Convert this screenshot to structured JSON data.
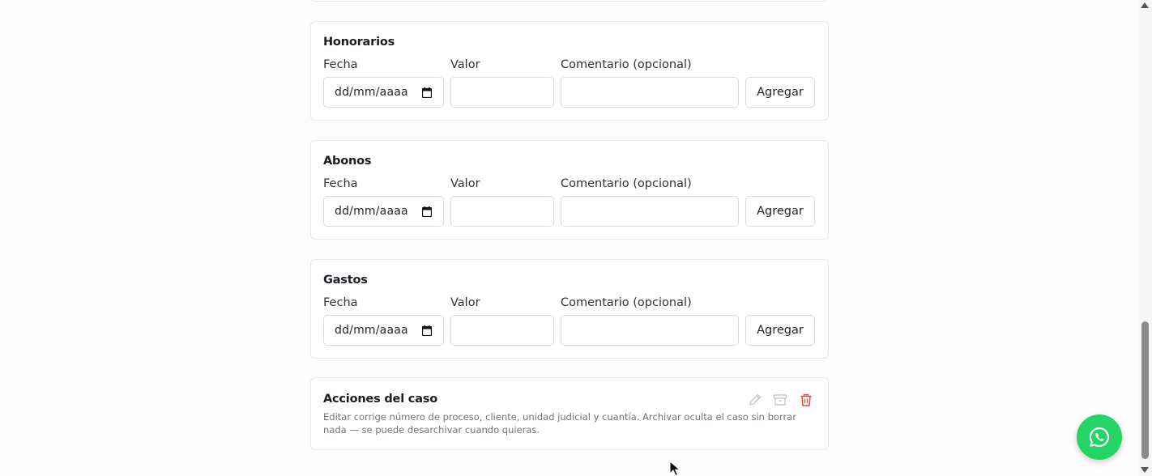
{
  "sections": [
    {
      "title": "Honorarios",
      "fecha_label": "Fecha",
      "valor_label": "Valor",
      "comentario_label": "Comentario (opcional)",
      "date_placeholder": "dd/mm/aaaa",
      "button_label": "Agregar"
    },
    {
      "title": "Abonos",
      "fecha_label": "Fecha",
      "valor_label": "Valor",
      "comentario_label": "Comentario (opcional)",
      "date_placeholder": "dd/mm/aaaa",
      "button_label": "Agregar"
    },
    {
      "title": "Gastos",
      "fecha_label": "Fecha",
      "valor_label": "Valor",
      "comentario_label": "Comentario (opcional)",
      "date_placeholder": "dd/mm/aaaa",
      "button_label": "Agregar"
    }
  ],
  "acciones": {
    "title": "Acciones del caso",
    "description": "Editar corrige número de proceso, cliente, unidad judicial y cuantía. Archivar oculta el caso sin borrar nada — se puede desarchivar cuando quieras.",
    "icons": [
      "edit-pencil-icon",
      "archive-box-icon",
      "trash-icon"
    ]
  },
  "colors": {
    "whatsapp": "#25d366",
    "delete": "#e5484d",
    "muted_icon": "#c3c7cd"
  }
}
